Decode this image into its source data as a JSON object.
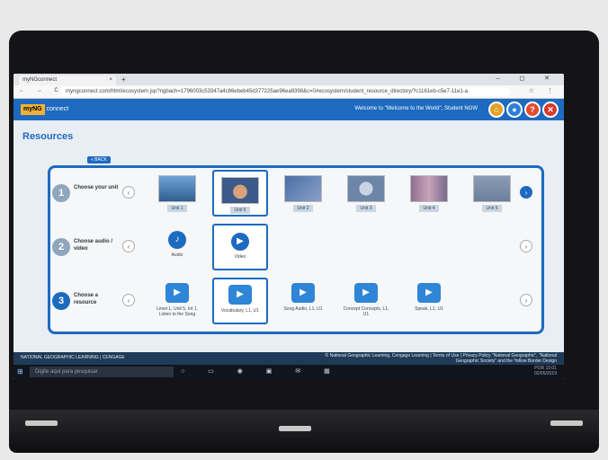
{
  "browser": {
    "tab_title": "myNGconnect",
    "url": "myngconnect.com/html/ecosystem.jsp?ngbach=1796003c53347a4c86ebeb45d377225ae96ea8398&c=0#ecosystem/student_resource_directory/?c1161eb-c5e7-11e1-a",
    "new_tab": "+",
    "nav_icons": "← → C",
    "window_controls": "– ◻ ✕"
  },
  "header": {
    "logo_box": "myNG",
    "logo_text": "connect",
    "welcome": "Welcome to \"Welcome to the World\", Student NGW",
    "home": "⌂",
    "user": "●",
    "help": "?",
    "close": "✕"
  },
  "page": {
    "title": "Resources",
    "back": "« BACK"
  },
  "step1": {
    "num": "1",
    "label": "Choose your unit",
    "units": [
      "Unit 1",
      "Unit 5",
      "Unit 2",
      "Unit 3",
      "Unit 4",
      "Unit 5"
    ]
  },
  "step2": {
    "num": "2",
    "label": "Choose audio / video",
    "options": [
      "Audio",
      "Video"
    ]
  },
  "step3": {
    "num": "3",
    "label": "Choose a resource",
    "resources": [
      "Level 1, Unit 5, Int 1, Listen to the Song",
      "Vocabulary, L1, U1",
      "Song Audio, L1, U1",
      "Concept Concepts, L1, U1",
      "Speak, L1, U1"
    ]
  },
  "footer": {
    "left": "NATIONAL GEOGRAPHIC LEARNING | CENGAGE",
    "right": "© National Geographic Learning, Cengage Learning | Terms of Use | Privacy Policy \"National Geographic\", \"National Geographic Society\" and the Yellow Border Design"
  },
  "taskbar": {
    "search": "Digite aqui para pesquisar",
    "time": "10:01",
    "lang": "POR",
    "date": "02/05/2019"
  },
  "colors": {
    "accent": "#1e6ac0",
    "header": "#1e6ac0"
  }
}
